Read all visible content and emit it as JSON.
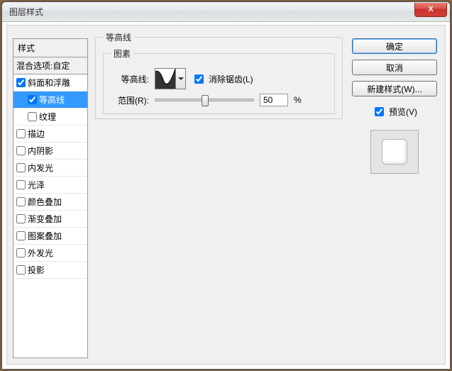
{
  "window": {
    "title": "图层样式"
  },
  "sidebar": {
    "header": "样式",
    "blend": "混合选项:自定",
    "items": [
      {
        "label": "斜面和浮雕",
        "checked": true
      },
      {
        "label": "等高线",
        "checked": true,
        "sub": true,
        "selected": true
      },
      {
        "label": "纹理",
        "checked": false,
        "sub": true
      },
      {
        "label": "描边",
        "checked": false
      },
      {
        "label": "内阴影",
        "checked": false
      },
      {
        "label": "内发光",
        "checked": false
      },
      {
        "label": "光泽",
        "checked": false
      },
      {
        "label": "颜色叠加",
        "checked": false
      },
      {
        "label": "渐变叠加",
        "checked": false
      },
      {
        "label": "图案叠加",
        "checked": false
      },
      {
        "label": "外发光",
        "checked": false
      },
      {
        "label": "投影",
        "checked": false
      }
    ]
  },
  "center": {
    "outer_legend": "等高线",
    "inner_legend": "图素",
    "contour_label": "等高线:",
    "antialias_label": "消除锯齿(L)",
    "antialias_checked": true,
    "range_label": "范围(R):",
    "range_value": "50",
    "range_unit": "%"
  },
  "right": {
    "ok": "确定",
    "cancel": "取消",
    "new_style": "新建样式(W)...",
    "preview_label": "预览(V)",
    "preview_checked": true
  }
}
